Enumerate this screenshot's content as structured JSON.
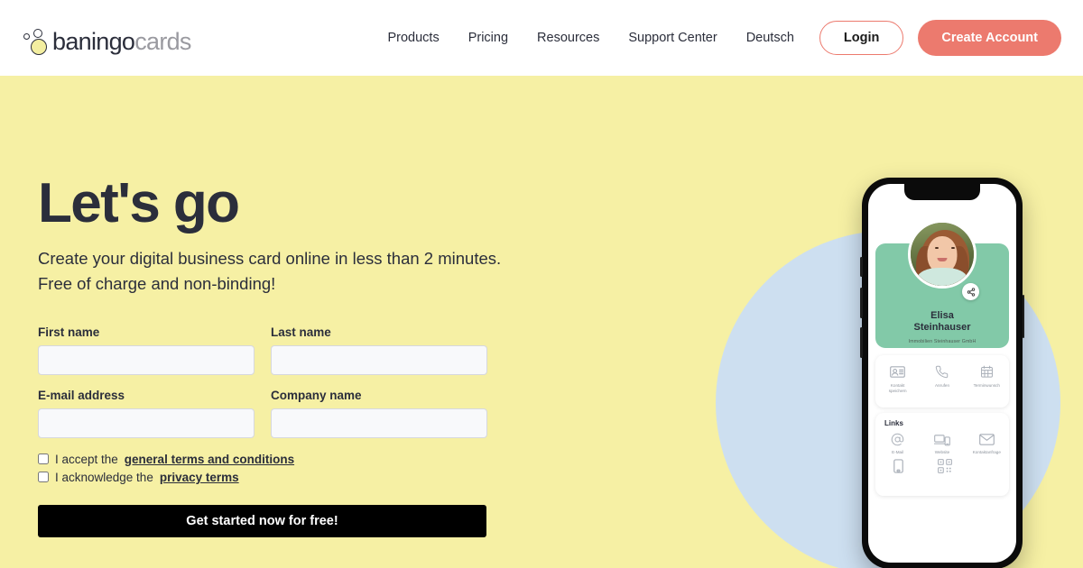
{
  "brand": {
    "name_bold": "baningo",
    "name_light": "cards"
  },
  "nav": {
    "items": [
      {
        "label": "Products"
      },
      {
        "label": "Pricing"
      },
      {
        "label": "Resources"
      },
      {
        "label": "Support Center"
      },
      {
        "label": "Deutsch"
      }
    ],
    "login_label": "Login",
    "create_account_label": "Create Account"
  },
  "hero": {
    "headline": "Let's go",
    "subline_1": "Create your digital business card online in less than 2 minutes.",
    "subline_2": "Free of charge and non-binding!"
  },
  "form": {
    "fields": [
      {
        "label": "First name",
        "value": "",
        "placeholder": ""
      },
      {
        "label": "Last name",
        "value": "",
        "placeholder": ""
      },
      {
        "label": "E-mail address",
        "value": "",
        "placeholder": ""
      },
      {
        "label": "Company name",
        "value": "",
        "placeholder": ""
      }
    ],
    "consents": [
      {
        "prefix": "I accept the ",
        "link": "general terms and conditions",
        "checked": false
      },
      {
        "prefix": "I acknowledge the ",
        "link": "privacy terms",
        "checked": false
      }
    ],
    "submit_label": "Get started now for free!"
  },
  "phone_card": {
    "name_line_1": "Elisa",
    "name_line_2": "Steinhauser",
    "company": "Immobilien Steinhauser GmbH",
    "share_icon": "share-icon",
    "actions": [
      {
        "icon": "contact-card-icon",
        "label_1": "Kontakt",
        "label_2": "speichern"
      },
      {
        "icon": "phone-icon",
        "label_1": "Anrufen",
        "label_2": ""
      },
      {
        "icon": "calendar-icon",
        "label_1": "Terminwunsch",
        "label_2": ""
      }
    ],
    "links_title": "Links",
    "links": [
      {
        "icon": "at-sign-icon",
        "label": "E-Mail"
      },
      {
        "icon": "devices-icon",
        "label": "Website"
      },
      {
        "icon": "envelope-icon",
        "label": "Kontaktanfrage"
      }
    ],
    "links_row2": [
      {
        "icon": "mobile-icon",
        "label": ""
      },
      {
        "icon": "qr-code-icon",
        "label": ""
      }
    ]
  },
  "colors": {
    "background_yellow": "#F6F0A4",
    "accent_coral": "#EC7A6E",
    "card_green": "#82C9A8",
    "circle_blue": "#CDDFF0",
    "text_dark": "#2B2E3B",
    "submit_black": "#000000"
  }
}
